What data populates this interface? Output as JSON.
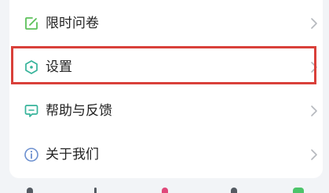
{
  "menu": {
    "items": [
      {
        "label": "限时问卷",
        "icon": "edit-icon",
        "icon_color": "#5cc15a"
      },
      {
        "label": "设置",
        "icon": "settings-hexagon-icon",
        "icon_color": "#36b39a",
        "highlighted": true
      },
      {
        "label": "帮助与反馈",
        "icon": "feedback-icon",
        "icon_color": "#36b39a"
      },
      {
        "label": "关于我们",
        "icon": "info-icon",
        "icon_color": "#6b8fcf"
      }
    ],
    "highlight_color": "#d9403a",
    "chevron_icon": "chevron-right-icon"
  }
}
